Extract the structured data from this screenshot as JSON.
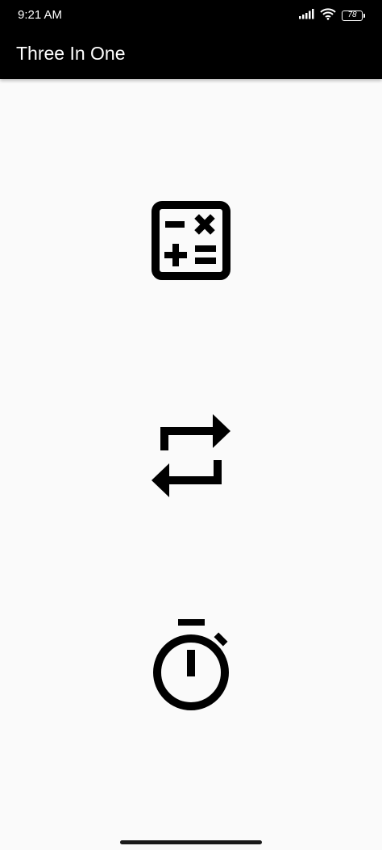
{
  "status_bar": {
    "time": "9:21 AM",
    "battery_level": "78",
    "icons": [
      "signal-icon",
      "wifi-icon",
      "battery-icon"
    ]
  },
  "app_bar": {
    "title": "Three In One"
  },
  "tools": [
    {
      "icon": "calculator-icon"
    },
    {
      "icon": "repeat-convert-icon"
    },
    {
      "icon": "stopwatch-icon"
    }
  ],
  "colors": {
    "app_bar_background": "#000000",
    "content_background": "#fafafa",
    "icon_color": "#000000"
  }
}
